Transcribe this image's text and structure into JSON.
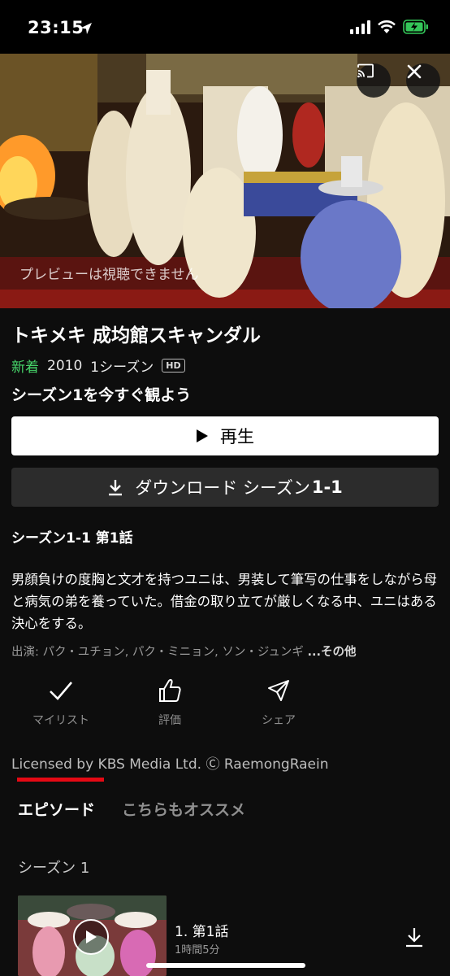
{
  "status_bar": {
    "time": "23:15"
  },
  "hero": {
    "preview_message": "プレビューは視聴できません"
  },
  "show": {
    "title": "トキメキ 成均館スキャンダル",
    "new_badge": "新着",
    "year": "2010",
    "seasons": "1シーズン",
    "quality": "HD",
    "watch_now": "シーズン1を今すぐ観よう"
  },
  "buttons": {
    "play_label": "再生",
    "download_label": "ダウンロード シーズン",
    "download_episode": "1-1"
  },
  "episode_info": {
    "heading": "シーズン1-1 第1話",
    "synopsis": "男顔負けの度胸と文才を持つユニは、男装して筆写の仕事をしながら母と病気の弟を養っていた。借金の取り立てが厳しくなる中、ユニはある決心をする。",
    "cast_prefix": "出演: パク・ユチョン, パク・ミニョン, ソン・ジュンギ",
    "cast_more": "...その他"
  },
  "actions": {
    "mylist": "マイリスト",
    "rate": "評価",
    "share": "シェア"
  },
  "license": "Licensed by KBS Media Ltd. Ⓒ RaemongRaein",
  "tabs": {
    "episodes": "エピソード",
    "more_like_this": "こちらもオススメ"
  },
  "season_selector": "シーズン 1",
  "episodes": [
    {
      "title": "1. 第1話",
      "duration": "1時間5分"
    }
  ],
  "colors": {
    "accent_red": "#e50914",
    "new_green": "#46d369",
    "battery_green": "#34c759"
  }
}
